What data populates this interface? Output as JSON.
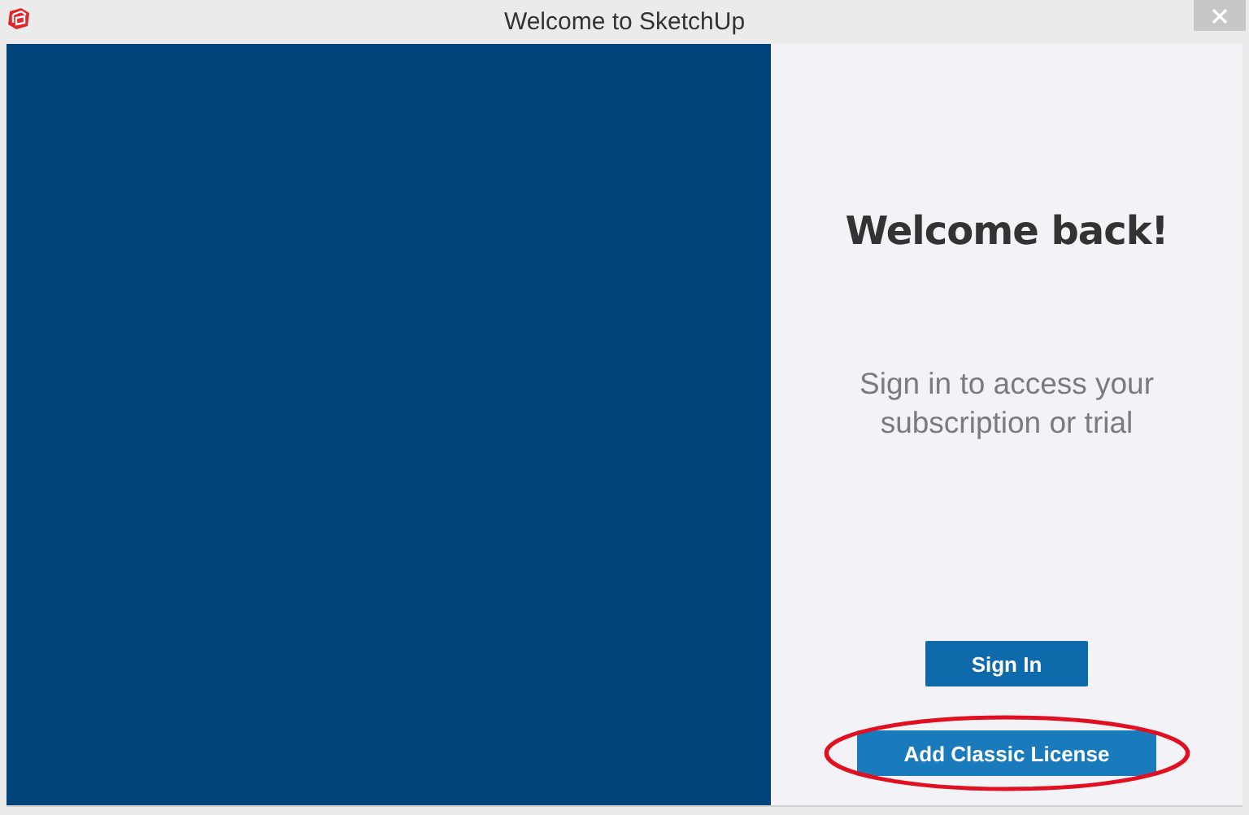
{
  "window": {
    "title": "Welcome to SketchUp"
  },
  "welcome": {
    "heading": "Welcome back!",
    "message": "Sign in to access your subscription or trial",
    "buttons": [
      {
        "label": "Sign In",
        "kind": "primary",
        "highlighted": false
      },
      {
        "label": "Add Classic License",
        "kind": "secondary",
        "highlighted": true
      }
    ]
  }
}
